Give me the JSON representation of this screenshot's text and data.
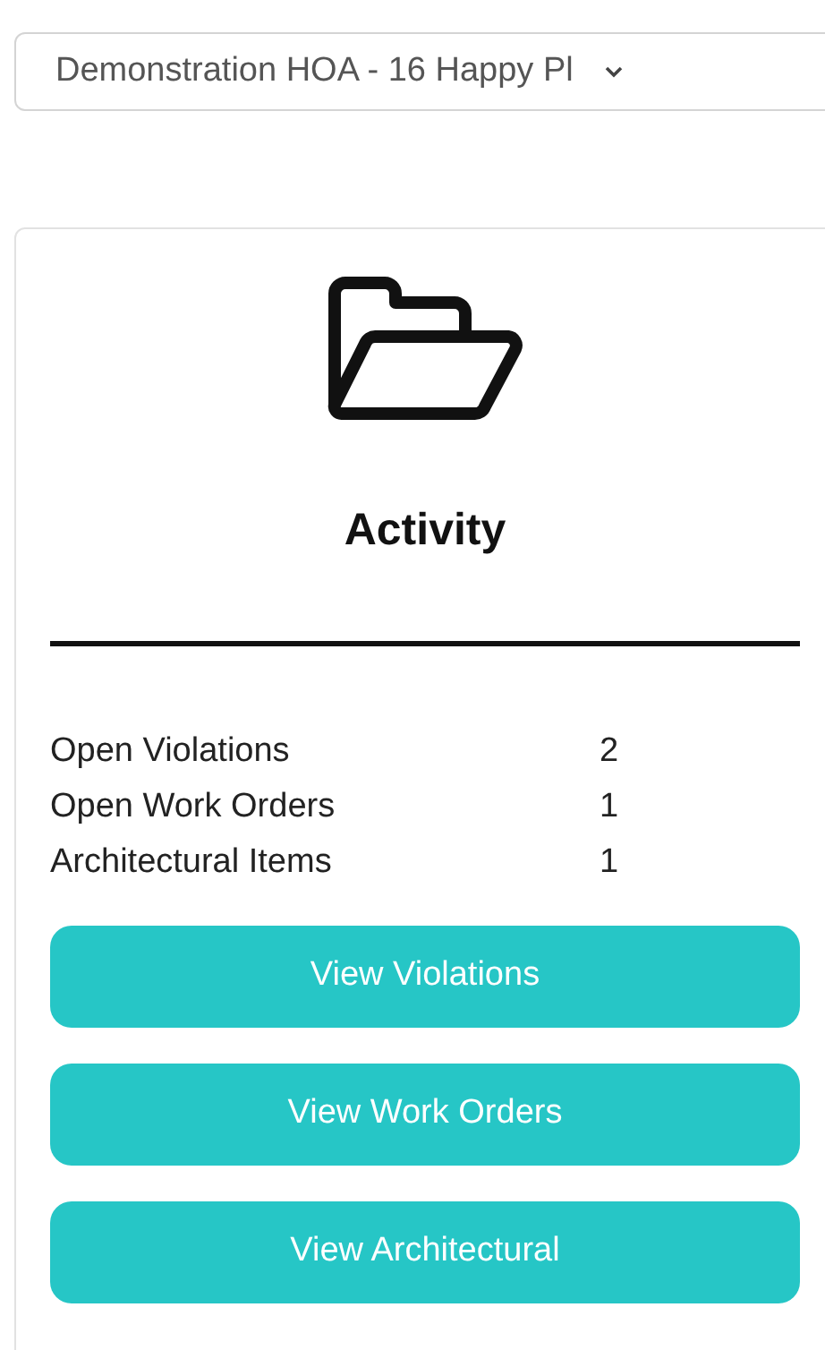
{
  "association_select": {
    "value": "Demonstration HOA - 16 Happy Pl"
  },
  "card": {
    "title": "Activity",
    "stats": [
      {
        "label": "Open Violations",
        "value": "2"
      },
      {
        "label": "Open Work Orders",
        "value": "1"
      },
      {
        "label": "Architectural Items",
        "value": "1"
      }
    ],
    "buttons": [
      "View Violations",
      "View Work Orders",
      "View Architectural"
    ]
  }
}
